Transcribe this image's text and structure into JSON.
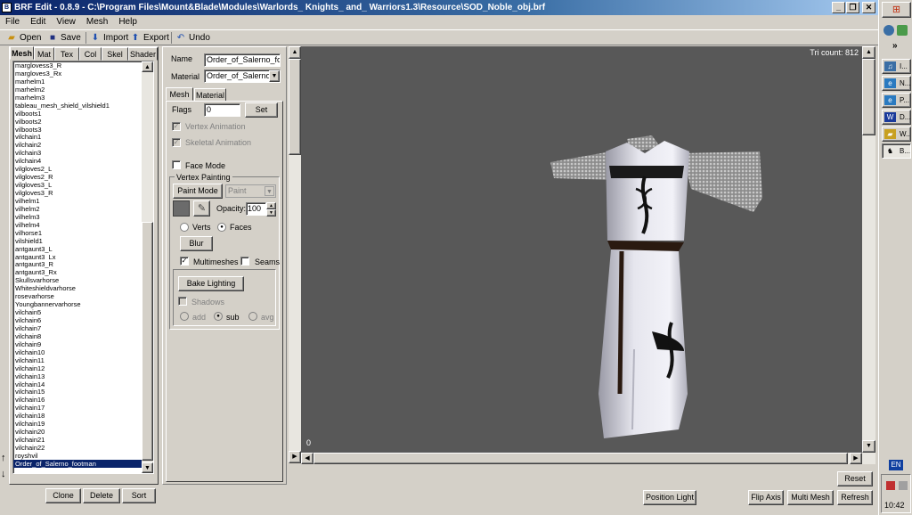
{
  "window": {
    "title": "BRF Edit - 0.8.9  -  C:\\Program Files\\Mount&Blade\\Modules\\Warlords_ Knights_ and_ Warriors1.3\\Resource\\SOD_Noble_obj.brf"
  },
  "menu": [
    "File",
    "Edit",
    "View",
    "Mesh",
    "Help"
  ],
  "toolbar": {
    "open": "Open",
    "save": "Save",
    "import": "Import",
    "export": "Export",
    "undo": "Undo"
  },
  "tabs": [
    "Mesh",
    "Mat",
    "Tex",
    "Col",
    "Skel",
    "Shader"
  ],
  "mesh_list": [
    "marglovess3_R",
    "margloves3_Rx",
    "marhelm1",
    "marhelm2",
    "marhelm3",
    "tableau_mesh_shield_vilshield1",
    "vilboots1",
    "vilboots2",
    "vilboots3",
    "vilchain1",
    "vilchain2",
    "vilchain3",
    "vilchain4",
    "vilgloves2_L",
    "vilgloves2_R",
    "vilgloves3_L",
    "vilgloves3_R",
    "vilhelm1",
    "vilhelm2",
    "vilhelm3",
    "vilhelm4",
    "vilhorse1",
    "vilshield1",
    "antgaunt3_L",
    "antgaunt3_Lx",
    "antgaunt3_R",
    "antgaunt3_Rx",
    "Skullsvarhorse",
    "Whiteshieldvarhorse",
    "rosevarhorse",
    "Youngbannervarhorse",
    "vilchain5",
    "vilchain6",
    "vilchain7",
    "vilchain8",
    "vilchain9",
    "vilchain10",
    "vilchain11",
    "vilchain12",
    "vilchain13",
    "vilchain14",
    "vilchain15",
    "vilchain16",
    "vilchain17",
    "vilchain18",
    "vilchain19",
    "vilchain20",
    "vilchain21",
    "vilchain22",
    "royshvil",
    "Order_of_Salerno_footman"
  ],
  "list_buttons": {
    "clone": "Clone",
    "delete": "Delete",
    "sort": "Sort"
  },
  "props": {
    "name_label": "Name",
    "name_value": "Order_of_Salerno_foot",
    "material_label": "Material",
    "material_value": "Order_of_Salerno_f",
    "subtabs": [
      "Mesh",
      "Material"
    ],
    "flags_label": "Flags",
    "flags_value": "0",
    "set_button": "Set",
    "vertex_animation": "Vertex Animation",
    "skeletal_animation": "Skeletal Animation",
    "face_mode": "Face Mode",
    "vertex_painting": "Vertex Painting",
    "paint_mode": "Paint Mode",
    "paint_select": "Paint",
    "opacity_label": "Opacity:",
    "opacity_value": "100",
    "verts": "Verts",
    "faces": "Faces",
    "blur": "Blur",
    "multimeshes": "Multimeshes",
    "seams": "Seams",
    "bake_lighting": "Bake Lighting",
    "shadows": "Shadows",
    "add": "add",
    "sub": "sub",
    "avg": "avg"
  },
  "viewport": {
    "tri_count": "Tri count: 812",
    "frame": "0",
    "bg_color": "#585858"
  },
  "bottom_buttons": {
    "reset": "Reset",
    "position_light": "Position Light",
    "flip_axis": "Flip Axis",
    "multi_mesh": "Multi Mesh",
    "refresh": "Refresh"
  },
  "taskbar": {
    "items": [
      "I...",
      "N...",
      "P...",
      "D...",
      "W...",
      "B..."
    ],
    "lang": "EN",
    "clock": "10:42"
  }
}
